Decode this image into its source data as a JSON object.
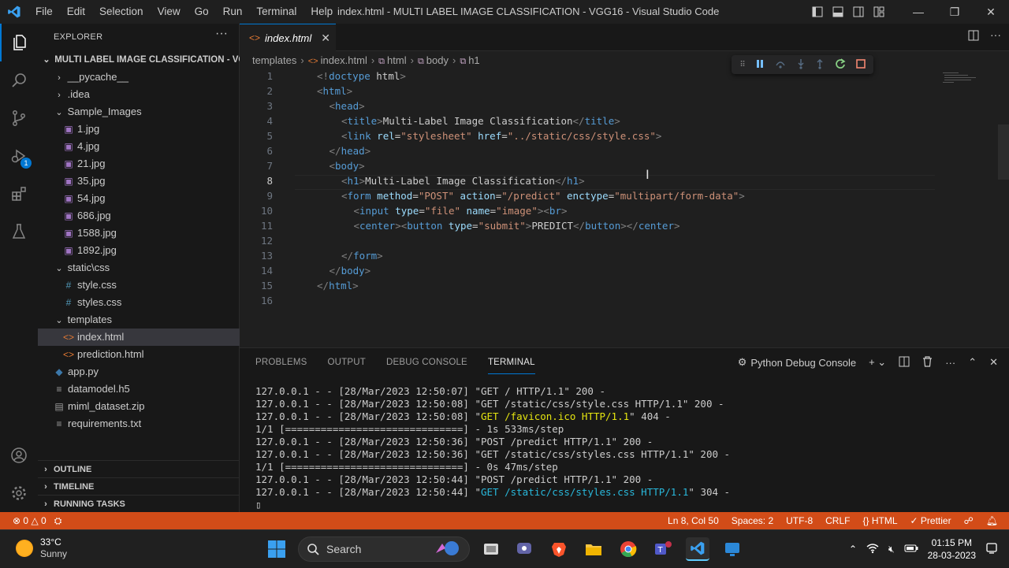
{
  "titlebar": {
    "menus": [
      "File",
      "Edit",
      "Selection",
      "View",
      "Go",
      "Run",
      "Terminal",
      "Help"
    ],
    "title": "index.html - MULTI LABEL IMAGE CLASSIFICATION - VGG16 - Visual Studio Code"
  },
  "activity_badge": "1",
  "sidebar": {
    "header": "EXPLORER",
    "root": "MULTI LABEL IMAGE CLASSIFICATION - VG...",
    "items": [
      {
        "label": "__pycache__",
        "type": "folder",
        "indent": 1,
        "expanded": false
      },
      {
        "label": ".idea",
        "type": "folder",
        "indent": 1,
        "expanded": false
      },
      {
        "label": "Sample_Images",
        "type": "folder",
        "indent": 1,
        "expanded": true
      },
      {
        "label": "1.jpg",
        "type": "image",
        "indent": 2
      },
      {
        "label": "4.jpg",
        "type": "image",
        "indent": 2
      },
      {
        "label": "21.jpg",
        "type": "image",
        "indent": 2
      },
      {
        "label": "35.jpg",
        "type": "image",
        "indent": 2
      },
      {
        "label": "54.jpg",
        "type": "image",
        "indent": 2
      },
      {
        "label": "686.jpg",
        "type": "image",
        "indent": 2
      },
      {
        "label": "1588.jpg",
        "type": "image",
        "indent": 2
      },
      {
        "label": "1892.jpg",
        "type": "image",
        "indent": 2
      },
      {
        "label": "static\\css",
        "type": "folder",
        "indent": 1,
        "expanded": true
      },
      {
        "label": "style.css",
        "type": "css",
        "indent": 2
      },
      {
        "label": "styles.css",
        "type": "css",
        "indent": 2
      },
      {
        "label": "templates",
        "type": "folder",
        "indent": 1,
        "expanded": true
      },
      {
        "label": "index.html",
        "type": "html",
        "indent": 2,
        "selected": true
      },
      {
        "label": "prediction.html",
        "type": "html",
        "indent": 2
      },
      {
        "label": "app.py",
        "type": "python",
        "indent": 1
      },
      {
        "label": "datamodel.h5",
        "type": "file",
        "indent": 1
      },
      {
        "label": "miml_dataset.zip",
        "type": "zip",
        "indent": 1
      },
      {
        "label": "requirements.txt",
        "type": "file",
        "indent": 1
      }
    ],
    "sections": [
      "OUTLINE",
      "TIMELINE",
      "RUNNING TASKS"
    ]
  },
  "editor": {
    "tab_label": "index.html",
    "breadcrumb": [
      "templates",
      "index.html",
      "html",
      "body",
      "h1"
    ],
    "current_line": 8,
    "lines": [
      {
        "n": "1",
        "indent": 0,
        "tokens": [
          [
            "br",
            "<!"
          ],
          [
            "tag",
            "doctype"
          ],
          [
            "tx",
            " html"
          ],
          [
            "br",
            ">"
          ]
        ]
      },
      {
        "n": "2",
        "indent": 0,
        "tokens": [
          [
            "br",
            "<"
          ],
          [
            "tag",
            "html"
          ],
          [
            "br",
            ">"
          ]
        ]
      },
      {
        "n": "3",
        "indent": 1,
        "tokens": [
          [
            "br",
            "<"
          ],
          [
            "tag",
            "head"
          ],
          [
            "br",
            ">"
          ]
        ]
      },
      {
        "n": "4",
        "indent": 2,
        "tokens": [
          [
            "br",
            "<"
          ],
          [
            "tag",
            "title"
          ],
          [
            "br",
            ">"
          ],
          [
            "tx",
            "Multi-Label Image Classification"
          ],
          [
            "br",
            "</"
          ],
          [
            "tag",
            "title"
          ],
          [
            "br",
            ">"
          ]
        ]
      },
      {
        "n": "5",
        "indent": 2,
        "tokens": [
          [
            "br",
            "<"
          ],
          [
            "tag",
            "link"
          ],
          [
            "at",
            " rel"
          ],
          [
            "tx",
            "="
          ],
          [
            "str",
            "\"stylesheet\""
          ],
          [
            "at",
            " href"
          ],
          [
            "tx",
            "="
          ],
          [
            "str",
            "\"../static/css/style.css\""
          ],
          [
            "br",
            ">"
          ]
        ]
      },
      {
        "n": "6",
        "indent": 1,
        "tokens": [
          [
            "br",
            "</"
          ],
          [
            "tag",
            "head"
          ],
          [
            "br",
            ">"
          ]
        ]
      },
      {
        "n": "7",
        "indent": 1,
        "tokens": [
          [
            "br",
            "<"
          ],
          [
            "tag",
            "body"
          ],
          [
            "br",
            ">"
          ]
        ]
      },
      {
        "n": "8",
        "indent": 2,
        "tokens": [
          [
            "br",
            "<"
          ],
          [
            "tag",
            "h1"
          ],
          [
            "br",
            ">"
          ],
          [
            "tx",
            "Multi-Label Image Classification"
          ],
          [
            "br",
            "</"
          ],
          [
            "tag",
            "h1"
          ],
          [
            "br",
            ">"
          ]
        ]
      },
      {
        "n": "9",
        "indent": 2,
        "tokens": [
          [
            "br",
            "<"
          ],
          [
            "tag",
            "form"
          ],
          [
            "at",
            " method"
          ],
          [
            "tx",
            "="
          ],
          [
            "str",
            "\"POST\""
          ],
          [
            "at",
            " action"
          ],
          [
            "tx",
            "="
          ],
          [
            "str",
            "\"/predict\""
          ],
          [
            "at",
            " enctype"
          ],
          [
            "tx",
            "="
          ],
          [
            "str",
            "\"multipart/form-data\""
          ],
          [
            "br",
            ">"
          ]
        ]
      },
      {
        "n": "10",
        "indent": 3,
        "tokens": [
          [
            "br",
            "<"
          ],
          [
            "tag",
            "input"
          ],
          [
            "at",
            " type"
          ],
          [
            "tx",
            "="
          ],
          [
            "str",
            "\"file\""
          ],
          [
            "at",
            " name"
          ],
          [
            "tx",
            "="
          ],
          [
            "str",
            "\"image\""
          ],
          [
            "br",
            "><"
          ],
          [
            "tag",
            "br"
          ],
          [
            "br",
            ">"
          ]
        ]
      },
      {
        "n": "11",
        "indent": 3,
        "tokens": [
          [
            "br",
            "<"
          ],
          [
            "tag",
            "center"
          ],
          [
            "br",
            "><"
          ],
          [
            "tag",
            "button"
          ],
          [
            "at",
            " type"
          ],
          [
            "tx",
            "="
          ],
          [
            "str",
            "\"submit\""
          ],
          [
            "br",
            ">"
          ],
          [
            "tx",
            "PREDICT"
          ],
          [
            "br",
            "</"
          ],
          [
            "tag",
            "button"
          ],
          [
            "br",
            "></"
          ],
          [
            "tag",
            "center"
          ],
          [
            "br",
            ">"
          ]
        ]
      },
      {
        "n": "12",
        "indent": 0,
        "tokens": []
      },
      {
        "n": "13",
        "indent": 2,
        "tokens": [
          [
            "br",
            "</"
          ],
          [
            "tag",
            "form"
          ],
          [
            "br",
            ">"
          ]
        ]
      },
      {
        "n": "14",
        "indent": 1,
        "tokens": [
          [
            "br",
            "</"
          ],
          [
            "tag",
            "body"
          ],
          [
            "br",
            ">"
          ]
        ]
      },
      {
        "n": "15",
        "indent": 0,
        "tokens": [
          [
            "br",
            "</"
          ],
          [
            "tag",
            "html"
          ],
          [
            "br",
            ">"
          ]
        ]
      },
      {
        "n": "16",
        "indent": 0,
        "tokens": []
      }
    ]
  },
  "panel": {
    "tabs": [
      "PROBLEMS",
      "OUTPUT",
      "DEBUG CONSOLE",
      "TERMINAL"
    ],
    "active_tab": "TERMINAL",
    "console_name": "Python Debug Console",
    "terminal_lines": [
      [
        [
          "n",
          "127.0.0.1 - - [28/Mar/2023 12:50:07] \"GET / HTTP/1.1\" 200 -"
        ]
      ],
      [
        [
          "n",
          "127.0.0.1 - - [28/Mar/2023 12:50:08] \"GET /static/css/style.css HTTP/1.1\" 200 -"
        ]
      ],
      [
        [
          "n",
          "127.0.0.1 - - [28/Mar/2023 12:50:08] \""
        ],
        [
          "yel",
          "GET /favicon.ico HTTP/1.1"
        ],
        [
          "n",
          "\" 404 -"
        ]
      ],
      [
        [
          "n",
          "1/1 [==============================] - 1s 533ms/step"
        ]
      ],
      [
        [
          "n",
          "127.0.0.1 - - [28/Mar/2023 12:50:36] \"POST /predict HTTP/1.1\" 200 -"
        ]
      ],
      [
        [
          "n",
          "127.0.0.1 - - [28/Mar/2023 12:50:36] \"GET /static/css/styles.css HTTP/1.1\" 200 -"
        ]
      ],
      [
        [
          "n",
          "1/1 [==============================] - 0s 47ms/step"
        ]
      ],
      [
        [
          "n",
          "127.0.0.1 - - [28/Mar/2023 12:50:44] \"POST /predict HTTP/1.1\" 200 -"
        ]
      ],
      [
        [
          "n",
          "127.0.0.1 - - [28/Mar/2023 12:50:44] \""
        ],
        [
          "cyan",
          "GET /static/css/styles.css HTTP/1.1"
        ],
        [
          "n",
          "\" 304 -"
        ]
      ]
    ]
  },
  "statusbar": {
    "errors": "0",
    "warnings": "0",
    "position": "Ln 8, Col 50",
    "spaces": "Spaces: 2",
    "encoding": "UTF-8",
    "eol": "CRLF",
    "language": "HTML",
    "prettier": "Prettier"
  },
  "taskbar": {
    "temp": "33°C",
    "weather": "Sunny",
    "search": "Search",
    "time": "01:15 PM",
    "date": "28-03-2023"
  }
}
